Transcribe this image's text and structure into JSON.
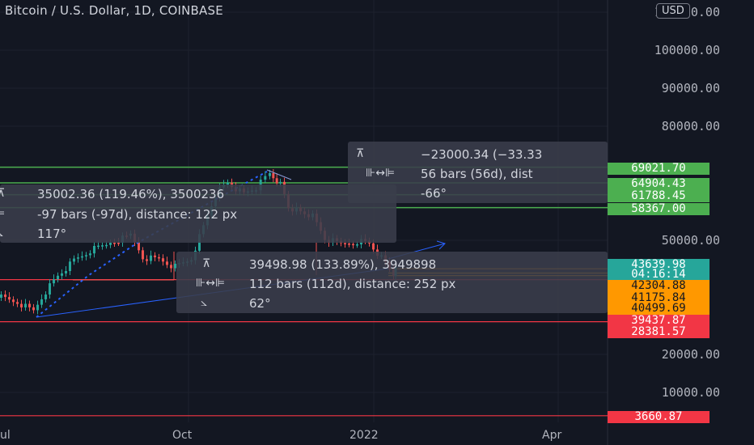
{
  "header": {
    "title": "Bitcoin / U.S. Dollar, 1D, COINBASE",
    "currency_button": "USD"
  },
  "colors": {
    "background": "#131722",
    "up": "#26a69a",
    "down": "#ef5350",
    "green_line": "#4caf50",
    "orange": "#ff9800",
    "blue_line": "#2962ff",
    "red_line": "#f23645"
  },
  "price_axis": {
    "labels": [
      "110000.00",
      "100000.00",
      "90000.00",
      "80000.00",
      "50000.00",
      "20000.00",
      "10000.00"
    ]
  },
  "time_axis": {
    "labels": [
      "ul",
      "Oct",
      "2022",
      "Apr"
    ]
  },
  "price_tags": [
    {
      "text": "69021.70",
      "color": "#4caf50",
      "price": 69021.7
    },
    {
      "text": "64904.43",
      "color": "#4caf50",
      "price": 64904.43
    },
    {
      "text": "61788.45",
      "color": "#4caf50",
      "price": 61788.45
    },
    {
      "text": "58367.00",
      "color": "#4caf50",
      "price": 58367.0
    },
    {
      "text": "43639.98",
      "color": "#26a69a",
      "price": 43639.98
    },
    {
      "text": "04:16:14",
      "color": "#26a69a",
      "price": null
    },
    {
      "text": "42304.88",
      "color": "#ff9800",
      "price": 42304.88
    },
    {
      "text": "41175.84",
      "color": "#ff9800",
      "price": 41175.84
    },
    {
      "text": "40499.69",
      "color": "#ff9800",
      "price": 40499.69
    },
    {
      "text": "39437.87",
      "color": "#f23645",
      "price": 39437.87
    },
    {
      "text": "28381.57",
      "color": "#f23645",
      "price": 28381.57
    },
    {
      "text": "3660.87",
      "color": "#f23645",
      "price": 3660.87
    }
  ],
  "measure_tooltips": [
    {
      "price_range": "−23000.34 (−33.33",
      "bars_range": "56 bars (56d), dist",
      "angle": "-66°"
    },
    {
      "price_range": "35002.36 (119.46%), 3500236",
      "bars_range": "-97 bars (-97d), distance: 122 px",
      "angle": "117°"
    },
    {
      "price_range": "39498.98 (133.89%), 3949898",
      "bars_range": "112 bars (112d), distance: 252 px",
      "angle": "62°"
    }
  ],
  "icons": {
    "price_range": "price-range-icon",
    "bars_range": "bars-range-icon",
    "angle": "angle-icon"
  }
}
